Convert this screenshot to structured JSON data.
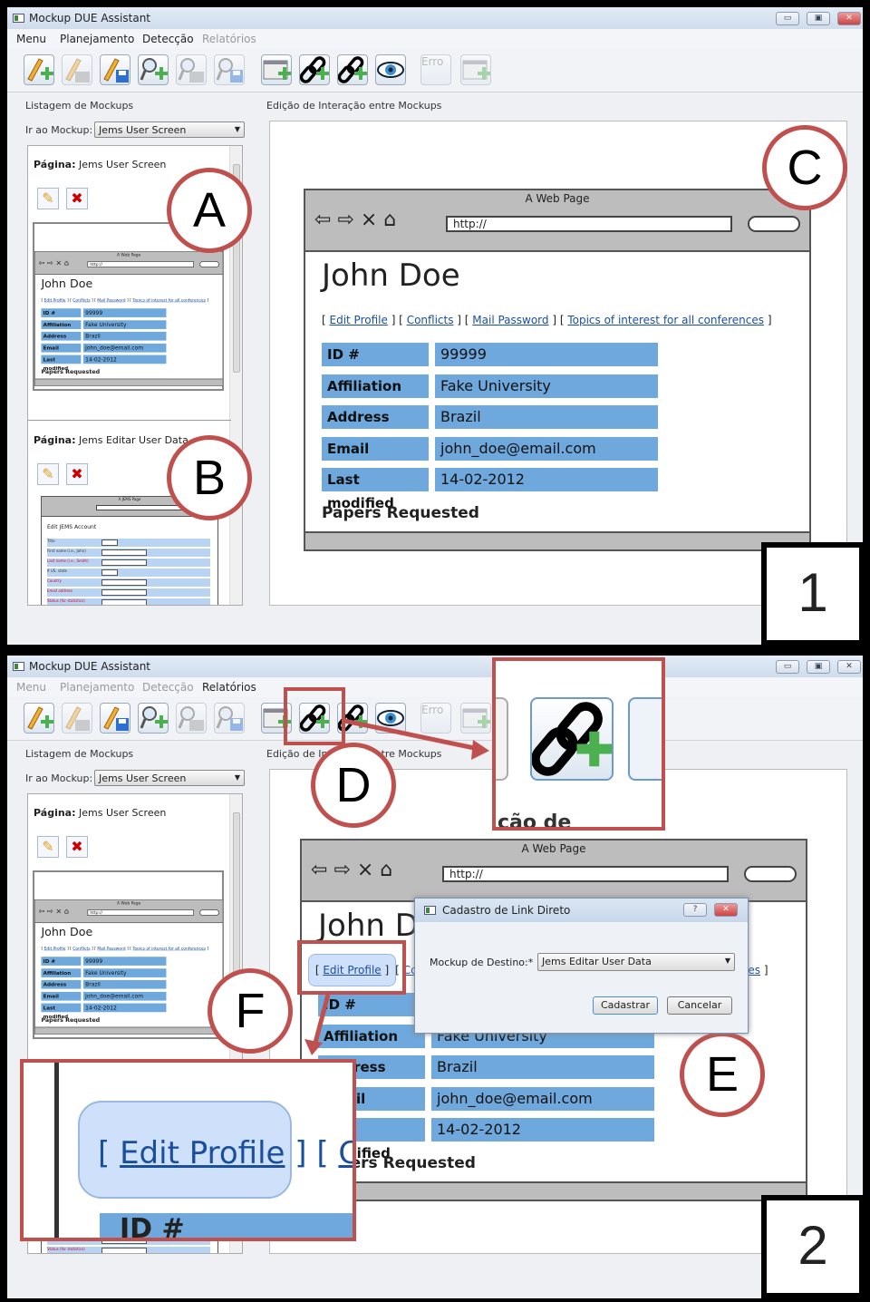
{
  "app": {
    "title": "Mockup DUE Assistant",
    "window_controls": [
      "minimize",
      "maximize",
      "close"
    ],
    "menu": [
      "Menu",
      "Planejamento",
      "Detecção",
      "Relatórios"
    ],
    "toolbar_icons": [
      "new-mockup-icon",
      "open-mockup-icon",
      "save-mockup-icon",
      "new-search-icon",
      "open-search-icon",
      "save-search-icon",
      "add-screen-icon",
      "add-link-icon",
      "add-conditional-link-icon",
      "preview-eye-icon",
      "add-error-icon",
      "add-item-icon"
    ],
    "toolbar_error_label": "Erro",
    "left_group_label": "Listagem de Mockups",
    "goto_label": "Ir ao Mockup:",
    "goto_value": "Jems User Screen",
    "page_prefix": "Página:",
    "pages": [
      {
        "name": "Jems User Screen"
      },
      {
        "name": "Jems Editar User Data"
      }
    ],
    "right_group_label": "Edição de Interação entre Mockups"
  },
  "mockup": {
    "title": "A Web Page",
    "url": "http://",
    "heading": "John Doe",
    "links": [
      "Edit Profile",
      "Conflicts",
      "Mail Password",
      "Topics of interest for all conferences"
    ],
    "rows": [
      {
        "label": "ID #",
        "value": "99999"
      },
      {
        "label": "Affiliation",
        "value": "Fake University"
      },
      {
        "label": "Address",
        "value": "Brazil"
      },
      {
        "label": "Email",
        "value": "john_doe@email.com"
      },
      {
        "label": "Last modified",
        "value": "14-02-2012"
      }
    ],
    "section": "Papers Requested"
  },
  "edit_mockup": {
    "title": "A JEMS Page",
    "heading": "Edit JEMS Account",
    "fields": [
      "Title",
      "First name (i.e., John)",
      "Last name (i.e., Smith)",
      "If US, state",
      "Country",
      "Email address",
      "Status (for statistics)"
    ]
  },
  "dialog": {
    "title": "Cadastro de Link Direto",
    "field_label": "Mockup de Destino:*",
    "field_value": "Jems Editar User Data",
    "submit": "Cadastrar",
    "cancel": "Cancelar"
  },
  "annotations": {
    "labels": [
      "A",
      "B",
      "C",
      "D",
      "E",
      "F"
    ],
    "panel_numbers": [
      "1",
      "2"
    ],
    "zoom_caption": "ção de Interaçã",
    "zoom_link_text": "Edit Profile",
    "zoom_next_letter": "C",
    "zoom_id": "ID #",
    "highlight_color": "#c0504d"
  },
  "colors": {
    "row_blue": "#6ea8dc",
    "titlebar": "#dbe6f3"
  }
}
